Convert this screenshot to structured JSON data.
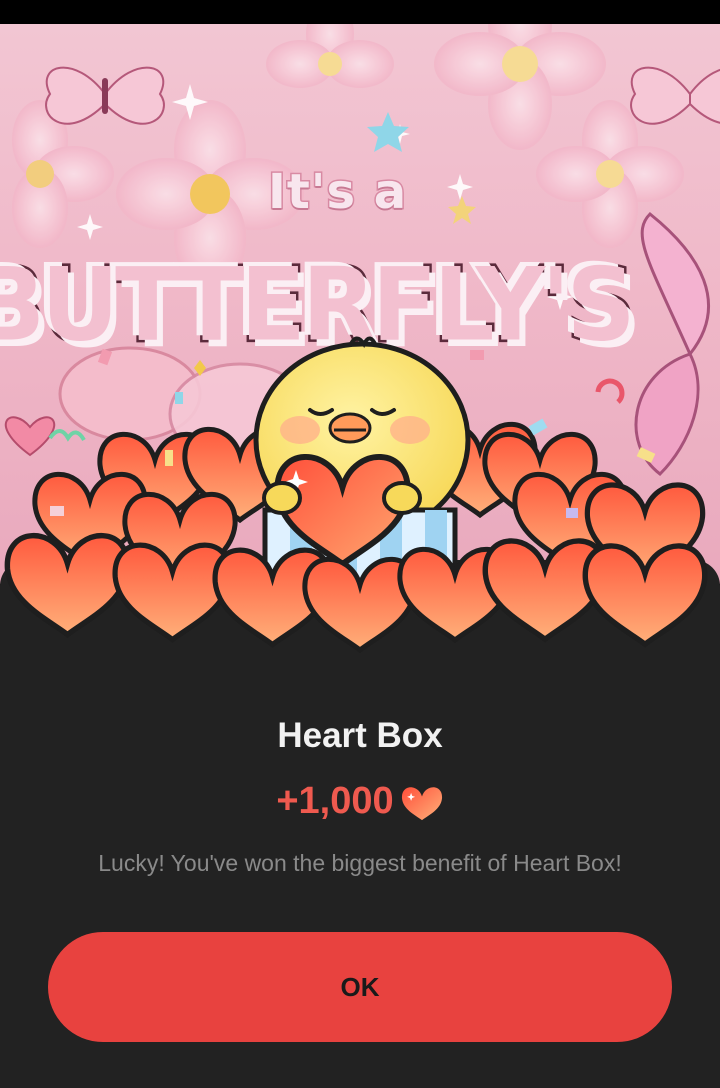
{
  "banner": {
    "headline_small": "It's a",
    "headline_big": "BUTTERFLY'S"
  },
  "dialog": {
    "title": "Heart Box",
    "reward_amount": "+1,000",
    "reward_icon": "heart-icon",
    "message": "Lucky! You've won the biggest benefit of Heart Box!",
    "ok_label": "OK"
  },
  "colors": {
    "accent": "#e8423f",
    "reward_text": "#ef5a4f",
    "sheet_background": "#222222",
    "banner_pink": "#f0b9c9"
  }
}
